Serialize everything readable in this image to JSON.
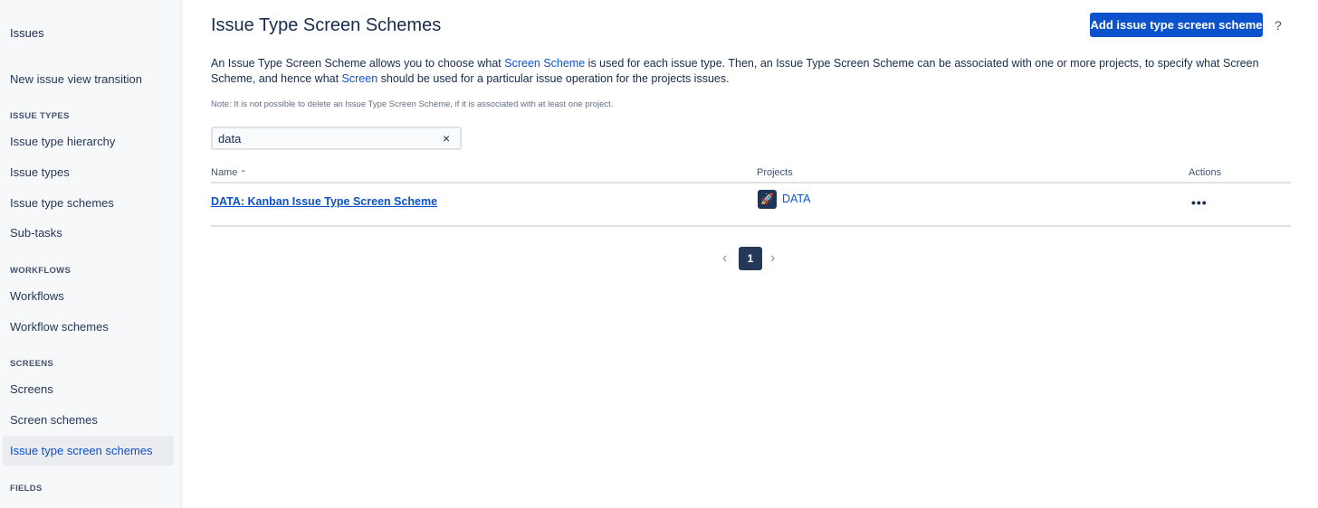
{
  "sidebar": {
    "title": "Issues",
    "items": [
      "New issue view transition",
      "Issue type hierarchy",
      "Issue types",
      "Issue type schemes",
      "Sub-tasks",
      "Workflows",
      "Workflow schemes",
      "Screens",
      "Screen schemes",
      "Issue type screen schemes"
    ],
    "headings": [
      "ISSUE TYPES",
      "WORKFLOWS",
      "SCREENS",
      "FIELDS"
    ]
  },
  "header": {
    "title": "Issue Type Screen Schemes",
    "add_button": "Add issue type screen scheme",
    "help": "?"
  },
  "description": {
    "p1": "An Issue Type Screen Scheme allows you to choose what ",
    "link1": "Screen Scheme",
    "p2": " is used for each issue type. Then, an Issue Type Screen Scheme can be associated with one or more projects, to specify what Screen Scheme, and hence what ",
    "link2": "Screen",
    "p3": " should be used for a particular issue operation for the projects issues.",
    "note": "Note: It is not possible to delete an Issue Type Screen Scheme, if it is associated with at least one project."
  },
  "search": {
    "value": "data",
    "clear": "×"
  },
  "table": {
    "columns": [
      "Name",
      "Projects",
      "Actions"
    ],
    "sort_indicator": "⌃",
    "rows": [
      {
        "name": "DATA: Kanban Issue Type Screen Scheme",
        "project": "DATA",
        "actions": "•••"
      }
    ]
  },
  "pagination": {
    "prev": "‹",
    "current": "1",
    "next": "›"
  }
}
